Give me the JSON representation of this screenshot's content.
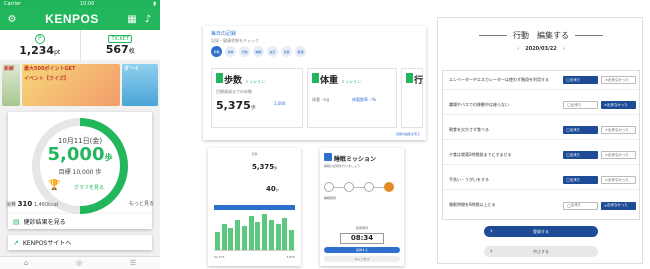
{
  "phone": {
    "status_carrier": "Carrier",
    "status_time": "10:00",
    "app_title": "KENPOS",
    "points_value": "1,234",
    "points_unit": "pt",
    "points_badge": "P",
    "ticket_badge": "TICKET",
    "tickets_value": "567",
    "tickets_unit": "枚",
    "banner1": "新鮮",
    "banner2": "最大500ポイントGET",
    "banner2b": "イベント【クイズ】",
    "banner3": "ダーイ",
    "date": "10月11日(金)",
    "steps": "5,000",
    "steps_unit": "歩",
    "goal": "目標 10,000 歩",
    "graph_link": "グラフを見る",
    "metric1": "310",
    "metric1_label": "消費",
    "metric2": "1,460",
    "metric2_label": "kcal",
    "more": "もっと見る",
    "nav1": "健診結果を見る",
    "nav2": "KENPOSサイトへ"
  },
  "dash": {
    "header": "毎日の記録",
    "sub": "記録・健康状態をチェック",
    "chips": [
      "歩数",
      "体重",
      "行動",
      "睡眠",
      "血圧",
      "食事",
      "飲酒"
    ],
    "card1_title": "歩数",
    "card1_badge": "ミッション",
    "card1_line": "目標達成までの歩数",
    "card1_value": "5,375",
    "card1_unit": "歩",
    "card1_sub": "1,000",
    "card2_title": "体重",
    "card2_badge": "ミッション",
    "card2_line": "体重 --kg",
    "card2_sub": "体脂肪率 --%",
    "card3_title": "行",
    "link": "目標の編集を見る"
  },
  "chart_panel": {
    "title": "歩数",
    "val1": "5,375",
    "val1_unit": "歩",
    "val2": "40",
    "val2_unit": "分",
    "footer_left": "52,375",
    "footer_right": "3,875"
  },
  "train_panel": {
    "title": "睡眠ミッション",
    "desc": "睡眠の記録を行いましょう",
    "caption": "睡眠時間",
    "label": "起床時刻",
    "time": "08:34",
    "btn1": "記録する",
    "btn2": "キャンセル"
  },
  "edit_panel": {
    "title": "行動　編集する",
    "date": "2020/03/22",
    "rows": [
      {
        "label": "エレベーターやエスカレーターは使わず階段を利用する",
        "on": "出来た",
        "off": "出来なかった"
      },
      {
        "label": "職場やバスでの移動中は座らない",
        "on": "出来た",
        "off": "出来なかった"
      },
      {
        "label": "朝食を欠かさず食べる",
        "on": "出来た",
        "off": "出来なかった"
      },
      {
        "label": "夕食は就寝2時間前までにすませる",
        "on": "出来た",
        "off": "出来なかった"
      },
      {
        "label": "手洗い・うがいをする",
        "on": "出来た",
        "off": "出来なかった"
      },
      {
        "label": "睡眠時間を6時間以上とる",
        "on": "出来た",
        "off": "出来なかった"
      }
    ],
    "primary": "登録する",
    "secondary": "中止する"
  },
  "colors": {
    "green": "#22b75c",
    "blue": "#2c6fcd",
    "navy": "#1d4b95"
  },
  "chart_data": {
    "type": "bar",
    "categories": [
      "1",
      "2",
      "3",
      "4",
      "5",
      "6",
      "7",
      "8",
      "9",
      "10",
      "11",
      "12"
    ],
    "values": [
      18,
      26,
      22,
      30,
      24,
      34,
      28,
      36,
      30,
      26,
      32,
      20
    ]
  }
}
